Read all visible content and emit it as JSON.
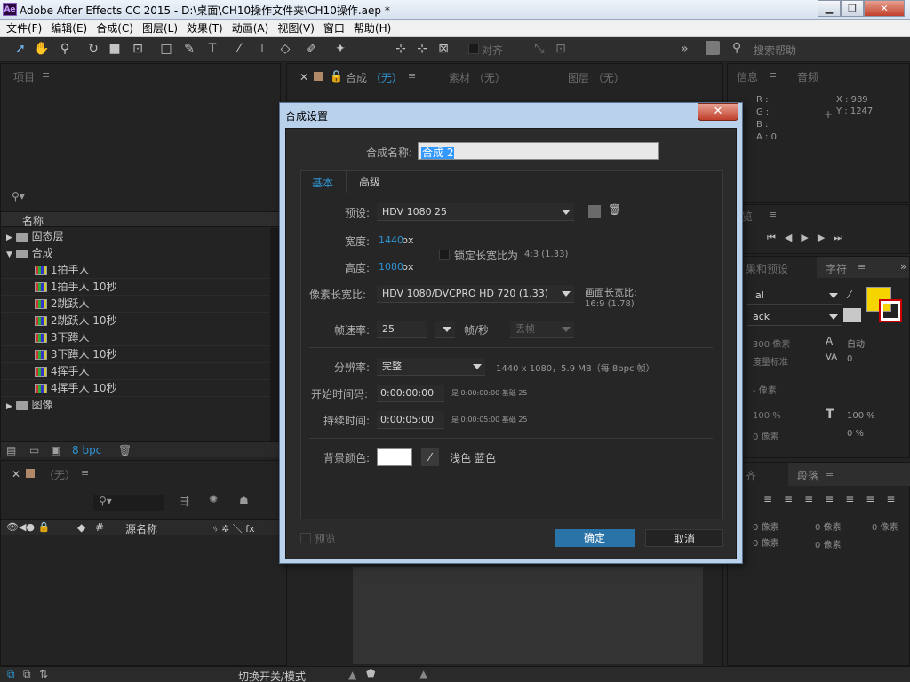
{
  "window": {
    "app_icon": "Ae",
    "title": "Adobe After Effects CC 2015 - D:\\桌面\\CH10操作文件夹\\CH10操作.aep *",
    "min": "▁",
    "max": "❐",
    "close": "✕"
  },
  "menu": [
    "文件(F)",
    "编辑(E)",
    "合成(C)",
    "图层(L)",
    "效果(T)",
    "动画(A)",
    "视图(V)",
    "窗口",
    "帮助(H)"
  ],
  "toolbar": {
    "align_label": "对齐",
    "more": "»",
    "search_placeholder": "搜索帮助"
  },
  "project_panel": {
    "title": "项目",
    "column_name": "名称",
    "items": [
      {
        "type": "folder",
        "label": "固态层",
        "expanded": false,
        "indent": 0
      },
      {
        "type": "folder",
        "label": "合成",
        "expanded": true,
        "indent": 0
      },
      {
        "type": "comp",
        "label": "1拍手人",
        "indent": 1
      },
      {
        "type": "comp",
        "label": "1拍手人 10秒",
        "indent": 1
      },
      {
        "type": "comp",
        "label": "2跳跃人",
        "indent": 1
      },
      {
        "type": "comp",
        "label": "2跳跃人 10秒",
        "indent": 1
      },
      {
        "type": "comp",
        "label": "3下蹲人",
        "indent": 1
      },
      {
        "type": "comp",
        "label": "3下蹲人 10秒",
        "indent": 1
      },
      {
        "type": "comp",
        "label": "4挥手人",
        "indent": 1
      },
      {
        "type": "comp",
        "label": "4挥手人 10秒",
        "indent": 1
      },
      {
        "type": "folder",
        "label": "图像",
        "expanded": false,
        "indent": 0
      }
    ],
    "bpc": "8 bpc"
  },
  "viewer_tabs": {
    "comp": "合成",
    "comp_none": "（无）",
    "footage": "素材 （无）",
    "layer": "图层 （无）"
  },
  "info_panel": {
    "tab_info": "信息",
    "tab_audio": "音频",
    "r": "R :",
    "g": "G :",
    "b": "B :",
    "a": "A : 0",
    "x": "X : 989",
    "y": "Y : 1247"
  },
  "preview_panel": {
    "tab": "览"
  },
  "effects_panel": {
    "tab_effects": "果和预设",
    "tab_char": "字符"
  },
  "char_panel": {
    "font": "ial",
    "style": "ack",
    "size": "300 像素",
    "leading": "自动",
    "tracking_label": "度量标准",
    "tracking": "0",
    "stroke": "- 像素",
    "vscale": "100 %",
    "hscale": "100 %",
    "baseline": "0 像素",
    "tsume": "0 %"
  },
  "para_panel": {
    "tab_align": "齐",
    "tab_para": "段落",
    "indent1": "0 像素",
    "indent2": "0 像素",
    "indent3": "0 像素",
    "space1": "0 像素",
    "space2": "0 像素"
  },
  "timeline": {
    "tab": "（无）",
    "source_name": "源名称",
    "toggle": "切换开关/模式"
  },
  "dialog": {
    "title": "合成设置",
    "close": "✕",
    "name_label": "合成名称:",
    "name_value": "合成 2",
    "tabs": [
      "基本",
      "高级"
    ],
    "preset_label": "预设:",
    "preset_value": "HDV 1080 25",
    "width_label": "宽度:",
    "width_value": "1440",
    "height_label": "高度:",
    "height_value": "1080",
    "px": "px",
    "lock_label": "锁定长宽比为",
    "lock_ratio": "4:3 (1.33)",
    "par_label": "像素长宽比:",
    "par_value": "HDV 1080/DVCPRO HD 720 (1.33)",
    "frame_ar_label": "画面长宽比:",
    "frame_ar_value": "16:9 (1.78)",
    "fps_label": "帧速率:",
    "fps_value": "25",
    "fps_unit": "帧/秒",
    "drop_value": "丢帧",
    "res_label": "分辨率:",
    "res_value": "完整",
    "res_info": "1440 x 1080，5.9 MB（每 8bpc 帧）",
    "start_label": "开始时间码:",
    "start_value": "0:00:00:00",
    "start_info": "是 0:00:00:00   基础 25",
    "dur_label": "持续时间:",
    "dur_value": "0:00:05:00",
    "dur_info": "是 0:00:05:00   基础 25",
    "bg_label": "背景颜色:",
    "bg_color": "#ffffff",
    "bg_name": "浅色 蓝色",
    "preview": "预览",
    "ok": "确定",
    "cancel": "取消"
  },
  "colors": {
    "accent": "#2f93d1",
    "ok_button": "#2a73a8",
    "fill_swatch": "#f5d400"
  }
}
